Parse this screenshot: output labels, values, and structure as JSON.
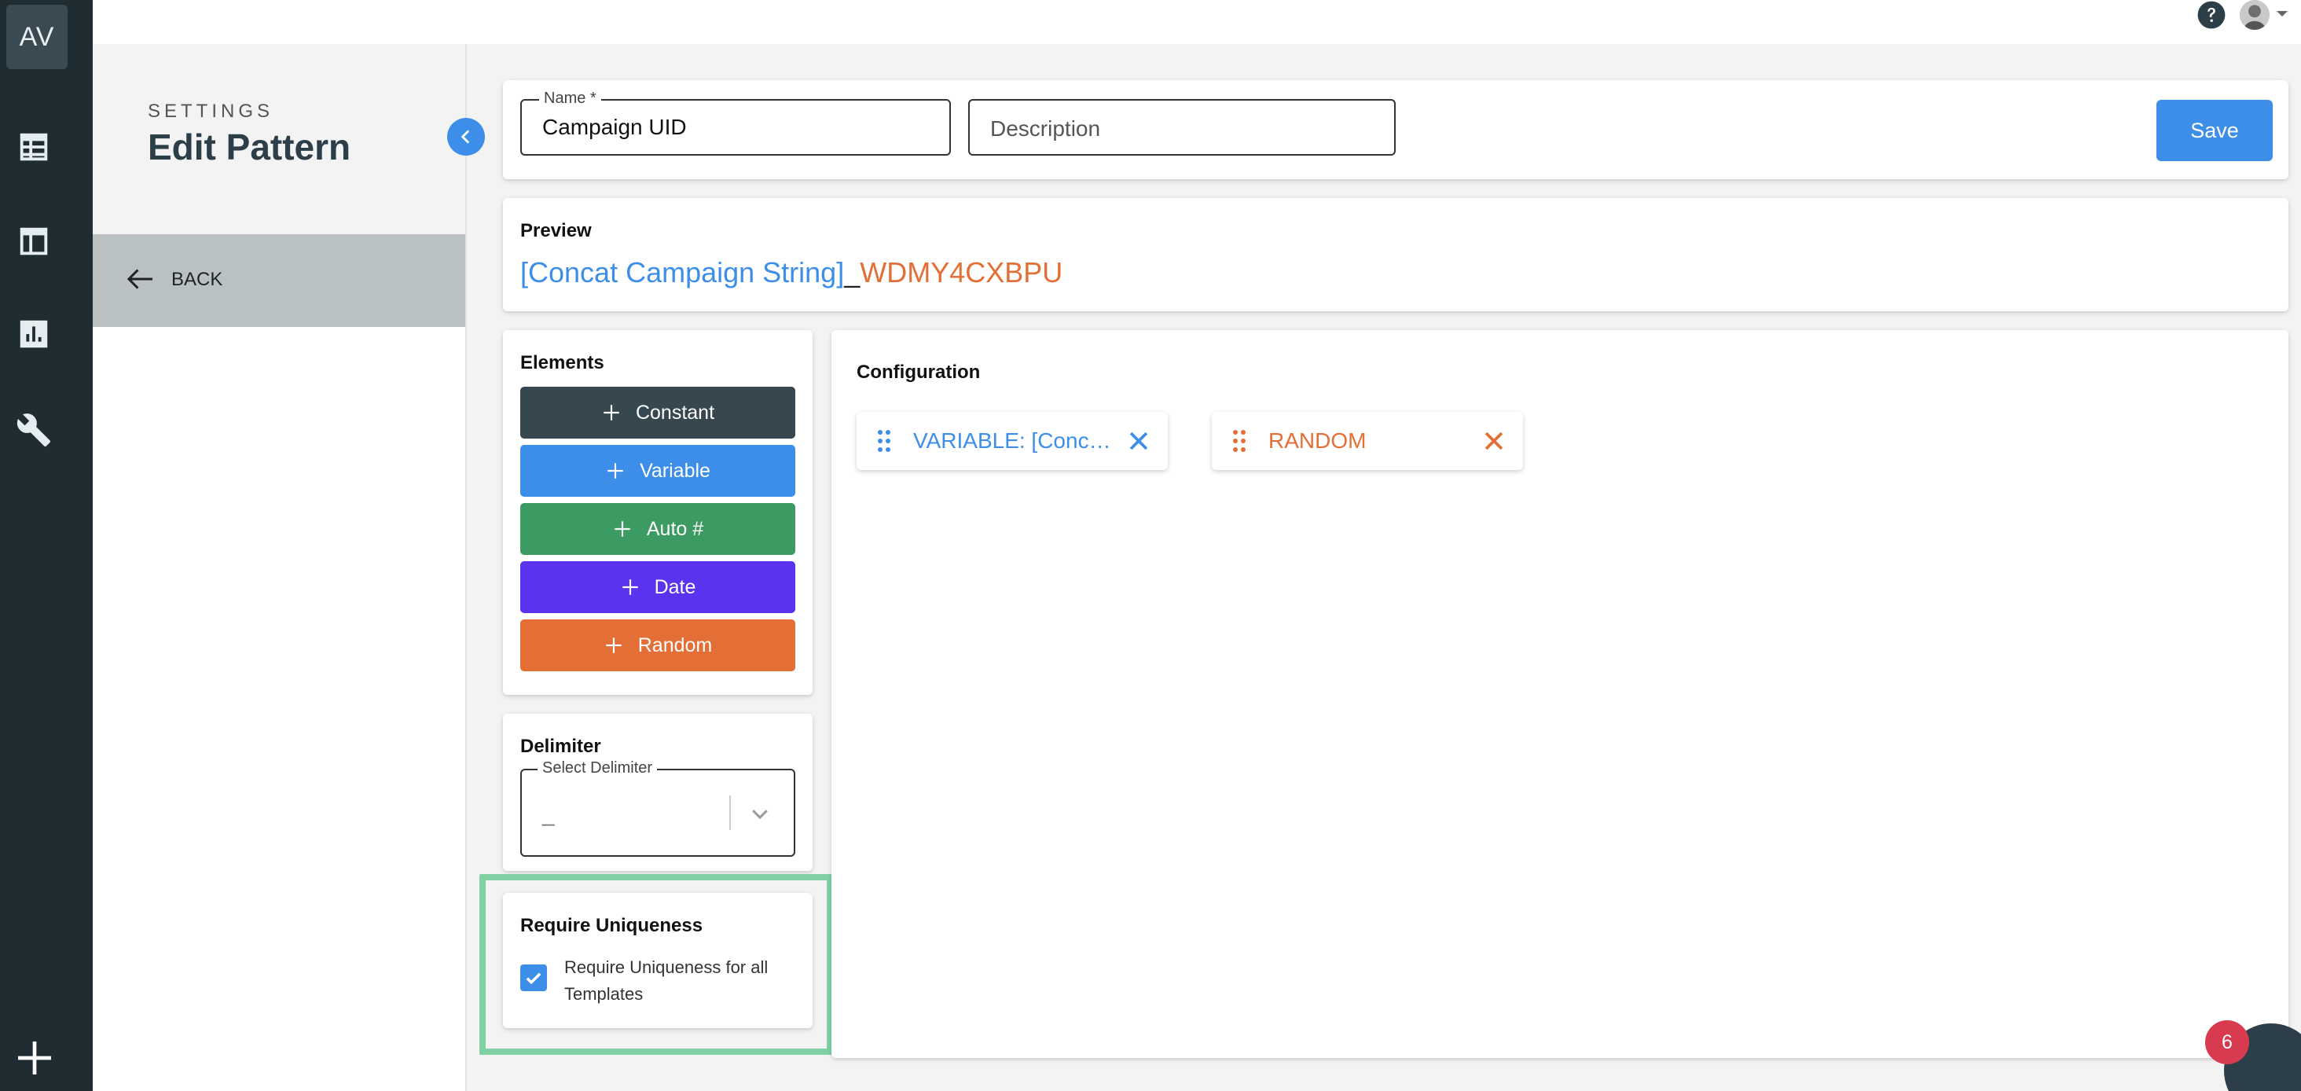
{
  "rail": {
    "logo": "AV",
    "icons": [
      "table-icon",
      "layout-icon",
      "chart-icon",
      "wrench-icon"
    ],
    "add_icon": "plus-icon"
  },
  "topbar": {
    "help_icon": "help-circle-icon",
    "avatar_icon": "user-avatar"
  },
  "side": {
    "section_label": "SETTINGS",
    "title": "Edit Pattern",
    "back_label": "BACK"
  },
  "form": {
    "name_label": "Name *",
    "name_value": "Campaign UID",
    "description_placeholder": "Description",
    "save_label": "Save"
  },
  "preview": {
    "title": "Preview",
    "variable_part": "[Concat Campaign String]",
    "delimiter": "_",
    "random_part": "WDMY4CXBPU"
  },
  "elements": {
    "title": "Elements",
    "buttons": [
      {
        "label": "Constant",
        "color": "#37474f"
      },
      {
        "label": "Variable",
        "color": "#3d8ee8"
      },
      {
        "label": "Auto #",
        "color": "#3c9b63"
      },
      {
        "label": "Date",
        "color": "#5b33ee"
      },
      {
        "label": "Random",
        "color": "#e46f36"
      }
    ]
  },
  "configuration": {
    "title": "Configuration",
    "chips": [
      {
        "label": "VARIABLE: [Concat Campaign String]",
        "color": "#3d8ee8"
      },
      {
        "label": "RANDOM",
        "color": "#e46f36"
      }
    ]
  },
  "delimiter": {
    "title": "Delimiter",
    "select_label": "Select Delimiter",
    "select_value": "_"
  },
  "uniqueness": {
    "title": "Require Uniqueness",
    "checkbox_label": "Require Uniqueness for all Templates",
    "checked": true
  },
  "notifications": {
    "badge_count": "6"
  }
}
